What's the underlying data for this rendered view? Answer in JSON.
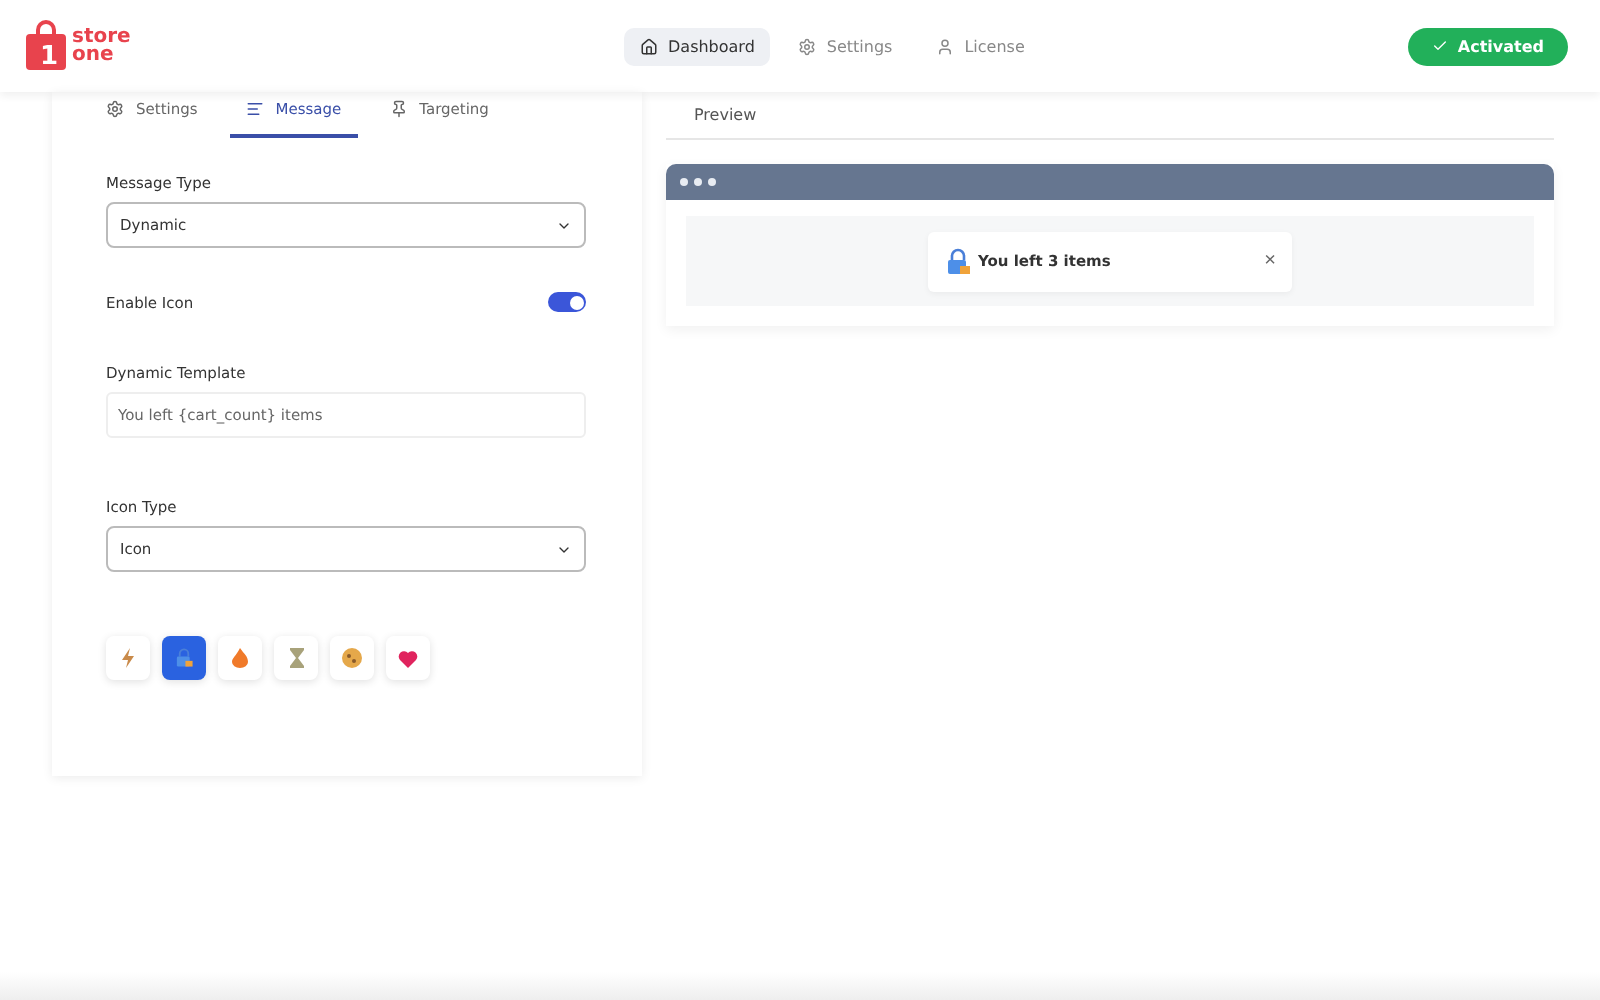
{
  "logo": {
    "mark": "1",
    "line1": "store",
    "line2": "one"
  },
  "nav": [
    {
      "label": "Dashboard",
      "kind": "home",
      "selected": true
    },
    {
      "label": "Settings",
      "kind": "gear",
      "selected": false
    },
    {
      "label": "License",
      "kind": "user",
      "selected": false
    }
  ],
  "status": {
    "label": "Activated",
    "active": true
  },
  "tabs": [
    {
      "label": "Settings",
      "kind": "gear",
      "selected": false
    },
    {
      "label": "Message",
      "kind": "lines",
      "selected": true
    },
    {
      "label": "Targeting",
      "kind": "pin",
      "selected": false
    }
  ],
  "form": {
    "message_type": {
      "label": "Message Type",
      "value": "Dynamic"
    },
    "enable_icon": {
      "label": "Enable Icon",
      "on": true
    },
    "template": {
      "label": "Dynamic Template",
      "value": "You left {cart_count} items"
    },
    "icon_type": {
      "label": "Icon Type",
      "value": "Icon"
    },
    "icons": [
      {
        "kind": "bolt",
        "selected": false
      },
      {
        "kind": "lock",
        "selected": true
      },
      {
        "kind": "fire",
        "selected": false
      },
      {
        "kind": "hourglass",
        "selected": false
      },
      {
        "kind": "cookie",
        "selected": false
      },
      {
        "kind": "heart",
        "selected": false
      }
    ]
  },
  "preview": {
    "title": "Preview",
    "message": "You left 3 items",
    "close": "×"
  }
}
